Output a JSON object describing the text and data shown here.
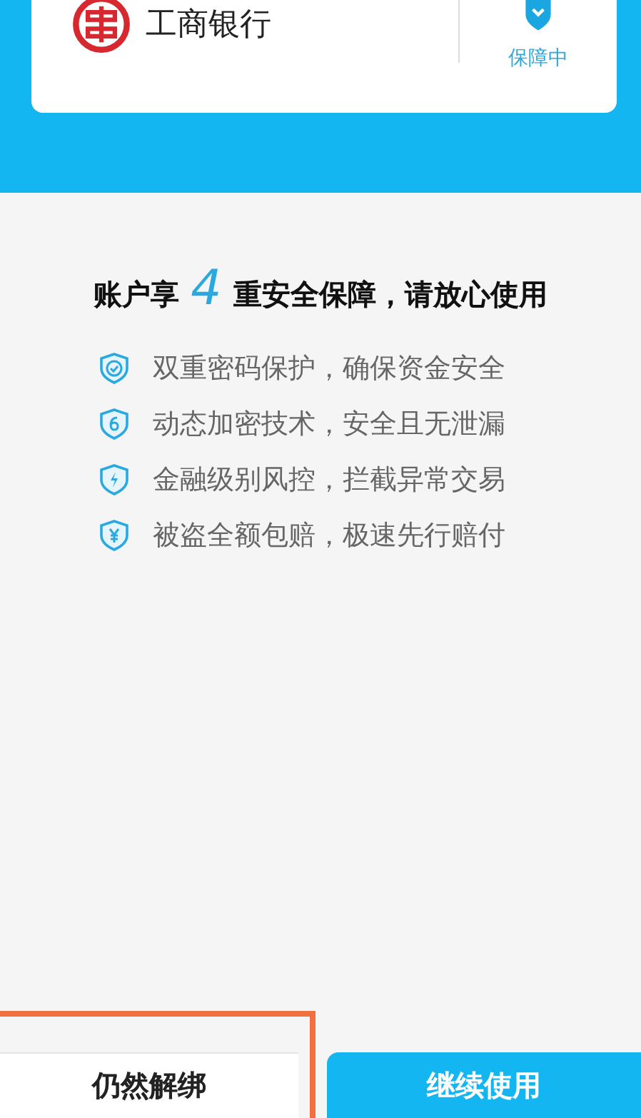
{
  "bank_card": {
    "bank_name": "工商银行",
    "status": "保障中"
  },
  "headline": {
    "prefix": "账户享",
    "number": "4",
    "suffix": "重安全保障，请放心使用"
  },
  "features": [
    {
      "kind": "check",
      "text": "双重密码保护，确保资金安全"
    },
    {
      "kind": "six",
      "text": "动态加密技术，安全且无泄漏"
    },
    {
      "kind": "bolt",
      "text": "金融级别风控，拦截异常交易"
    },
    {
      "kind": "yuan",
      "text": "被盗全额包赔，极速先行赔付"
    }
  ],
  "buttons": [
    {
      "kind": "secondary",
      "label": "仍然解绑",
      "highlighted": true
    },
    {
      "kind": "primary",
      "label": "继续使用",
      "highlighted": false
    }
  ]
}
